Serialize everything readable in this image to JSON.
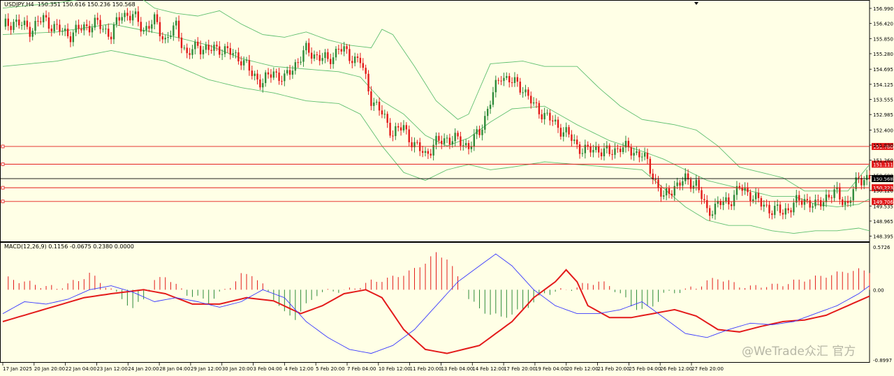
{
  "header": {
    "symbol": "USDJPY,H4",
    "ohlc": "150.351 150.616 150.236 150.568"
  },
  "macd_header": "MACD(12,26,9) 0.1156 -0.0675 0.2380 0.0000",
  "watermark": "@WeTrade众汇 官方",
  "colors": {
    "background": "#ffffe6",
    "bull": "#2e8b3a",
    "bear": "#e31a1a",
    "bands": "#5fbf6f",
    "macd_signal": "#e31a1a",
    "macd_main": "#3a3aff",
    "hline": "#e31a1a",
    "current_price": "#000000"
  },
  "chart_data": [
    {
      "type": "candlestick",
      "symbol": "USDJPY",
      "timeframe": "H4",
      "ylim": [
        148.2,
        157.2
      ],
      "price_ticks": [
        "156.990",
        "156.420",
        "155.850",
        "155.280",
        "154.695",
        "154.125",
        "153.555",
        "152.985",
        "152.400",
        "151.830",
        "151.260",
        "150.690",
        "150.120",
        "149.535",
        "148.965",
        "148.395"
      ],
      "time_labels": [
        "17 Jan 2025",
        "20 Jan 20:00",
        "22 Jan 04:00",
        "23 Jan 12:00",
        "24 Jan 20:00",
        "28 Jan 04:00",
        "29 Jan 12:00",
        "30 Jan 20:00",
        "3 Feb 04:00",
        "4 Feb 12:00",
        "5 Feb 20:00",
        "7 Feb 04:00",
        "10 Feb 12:00",
        "11 Feb 20:00",
        "13 Feb 04:00",
        "14 Feb 12:00",
        "17 Feb 20:00",
        "19 Feb 04:00",
        "20 Feb 12:00",
        "21 Feb 20:00",
        "25 Feb 04:00",
        "26 Feb 12:00",
        "27 Feb 20:00"
      ],
      "horizontal_lines": [
        {
          "price": 151.78,
          "label": "151.780"
        },
        {
          "price": 151.111,
          "label": "151.111"
        },
        {
          "price": 150.223,
          "label": "150.223"
        },
        {
          "price": 149.706,
          "label": "149.706"
        }
      ],
      "current_price": {
        "price": 150.568,
        "label": "150.568"
      },
      "close_path": [
        [
          0,
          156.3
        ],
        [
          4,
          156.5
        ],
        [
          10,
          156.2
        ],
        [
          15,
          156.6
        ],
        [
          20,
          156.2
        ],
        [
          25,
          156.0
        ],
        [
          30,
          156.3
        ],
        [
          35,
          156.4
        ],
        [
          40,
          156.0
        ],
        [
          44,
          156.8
        ],
        [
          48,
          156.7
        ],
        [
          52,
          156.2
        ],
        [
          56,
          156.5
        ],
        [
          60,
          155.8
        ],
        [
          64,
          156.3
        ],
        [
          68,
          155.2
        ],
        [
          72,
          155.6
        ],
        [
          76,
          155.4
        ],
        [
          80,
          155.5
        ],
        [
          84,
          155.3
        ],
        [
          88,
          155.1
        ],
        [
          92,
          154.5
        ],
        [
          96,
          154.2
        ],
        [
          100,
          154.6
        ],
        [
          104,
          154.3
        ],
        [
          108,
          154.9
        ],
        [
          112,
          155.4
        ],
        [
          116,
          155.2
        ],
        [
          120,
          155.0
        ],
        [
          124,
          155.5
        ],
        [
          128,
          155.2
        ],
        [
          132,
          155.0
        ],
        [
          136,
          153.6
        ],
        [
          140,
          153.0
        ],
        [
          144,
          152.3
        ],
        [
          148,
          152.5
        ],
        [
          152,
          151.8
        ],
        [
          156,
          151.5
        ],
        [
          160,
          151.9
        ],
        [
          164,
          152.1
        ],
        [
          168,
          152.0
        ],
        [
          172,
          151.8
        ],
        [
          176,
          152.3
        ],
        [
          180,
          153.5
        ],
        [
          184,
          154.5
        ],
        [
          188,
          154.2
        ],
        [
          192,
          154.0
        ],
        [
          196,
          153.3
        ],
        [
          200,
          153.0
        ],
        [
          204,
          152.6
        ],
        [
          208,
          152.3
        ],
        [
          212,
          151.8
        ],
        [
          216,
          151.6
        ],
        [
          220,
          151.7
        ],
        [
          224,
          151.5
        ],
        [
          228,
          151.8
        ],
        [
          232,
          151.6
        ],
        [
          236,
          151.5
        ],
        [
          240,
          150.7
        ],
        [
          244,
          149.8
        ],
        [
          248,
          150.3
        ],
        [
          252,
          150.5
        ],
        [
          256,
          150.4
        ],
        [
          260,
          149.3
        ],
        [
          264,
          149.6
        ],
        [
          268,
          149.7
        ],
        [
          272,
          150.2
        ],
        [
          276,
          150.0
        ],
        [
          280,
          149.6
        ],
        [
          284,
          149.4
        ],
        [
          288,
          149.3
        ],
        [
          292,
          149.6
        ],
        [
          296,
          149.8
        ],
        [
          300,
          149.5
        ],
        [
          304,
          149.9
        ],
        [
          308,
          150.0
        ],
        [
          312,
          149.6
        ],
        [
          316,
          150.6
        ],
        [
          320,
          150.57
        ]
      ],
      "bands_upper": [
        [
          0,
          157.0
        ],
        [
          20,
          157.2
        ],
        [
          40,
          157.5
        ],
        [
          48,
          157.6
        ],
        [
          56,
          157.0
        ],
        [
          64,
          156.8
        ],
        [
          72,
          156.7
        ],
        [
          80,
          156.9
        ],
        [
          88,
          156.4
        ],
        [
          96,
          156.0
        ],
        [
          104,
          155.9
        ],
        [
          112,
          156.1
        ],
        [
          120,
          155.8
        ],
        [
          128,
          155.6
        ],
        [
          136,
          155.5
        ],
        [
          140,
          156.2
        ],
        [
          144,
          156.0
        ],
        [
          152,
          154.8
        ],
        [
          160,
          153.5
        ],
        [
          168,
          152.8
        ],
        [
          172,
          153.0
        ],
        [
          180,
          154.9
        ],
        [
          192,
          155.0
        ],
        [
          200,
          154.8
        ],
        [
          212,
          154.8
        ],
        [
          220,
          154.0
        ],
        [
          228,
          153.3
        ],
        [
          236,
          152.8
        ],
        [
          248,
          152.6
        ],
        [
          256,
          152.4
        ],
        [
          264,
          151.8
        ],
        [
          272,
          151.0
        ],
        [
          280,
          150.8
        ],
        [
          288,
          150.6
        ],
        [
          296,
          150.1
        ],
        [
          304,
          150.1
        ],
        [
          312,
          150.1
        ],
        [
          320,
          151.1
        ]
      ],
      "bands_middle": [
        [
          0,
          156.0
        ],
        [
          20,
          156.1
        ],
        [
          40,
          156.4
        ],
        [
          60,
          156.0
        ],
        [
          76,
          155.6
        ],
        [
          88,
          155.1
        ],
        [
          100,
          154.8
        ],
        [
          112,
          154.7
        ],
        [
          124,
          154.6
        ],
        [
          132,
          154.4
        ],
        [
          140,
          153.5
        ],
        [
          148,
          153.0
        ],
        [
          156,
          152.2
        ],
        [
          164,
          151.8
        ],
        [
          172,
          152.1
        ],
        [
          180,
          152.7
        ],
        [
          188,
          153.2
        ],
        [
          200,
          153.3
        ],
        [
          212,
          152.6
        ],
        [
          224,
          152.0
        ],
        [
          236,
          151.6
        ],
        [
          244,
          151.3
        ],
        [
          252,
          150.9
        ],
        [
          260,
          150.5
        ],
        [
          268,
          150.3
        ],
        [
          276,
          150.1
        ],
        [
          284,
          149.9
        ],
        [
          292,
          149.9
        ],
        [
          300,
          149.6
        ],
        [
          308,
          149.5
        ],
        [
          316,
          149.6
        ],
        [
          320,
          149.8
        ]
      ],
      "bands_lower": [
        [
          0,
          154.8
        ],
        [
          20,
          155.0
        ],
        [
          40,
          155.4
        ],
        [
          60,
          155.0
        ],
        [
          76,
          154.3
        ],
        [
          88,
          154.0
        ],
        [
          100,
          153.8
        ],
        [
          112,
          153.5
        ],
        [
          124,
          153.4
        ],
        [
          132,
          153.0
        ],
        [
          140,
          151.8
        ],
        [
          148,
          150.8
        ],
        [
          156,
          150.5
        ],
        [
          164,
          150.9
        ],
        [
          172,
          151.1
        ],
        [
          180,
          150.9
        ],
        [
          188,
          151.0
        ],
        [
          200,
          151.2
        ],
        [
          212,
          151.1
        ],
        [
          224,
          151.0
        ],
        [
          236,
          150.9
        ],
        [
          244,
          150.2
        ],
        [
          252,
          149.5
        ],
        [
          260,
          149.0
        ],
        [
          268,
          148.8
        ],
        [
          276,
          148.8
        ],
        [
          284,
          148.6
        ],
        [
          292,
          148.5
        ],
        [
          300,
          148.6
        ],
        [
          308,
          148.6
        ],
        [
          316,
          148.7
        ],
        [
          320,
          148.6
        ]
      ]
    },
    {
      "type": "histogram_line",
      "name": "MACD(12,26,9)",
      "ylim": [
        -0.8997,
        0.5726
      ],
      "ticks": [
        "0.5726",
        "0.00",
        "-0.8997"
      ],
      "histogram_path": [
        [
          0,
          0.15
        ],
        [
          8,
          0.1
        ],
        [
          14,
          0.05
        ],
        [
          20,
          0.02
        ],
        [
          28,
          0.12
        ],
        [
          32,
          0.2
        ],
        [
          36,
          0.1
        ],
        [
          40,
          0.0
        ],
        [
          44,
          -0.1
        ],
        [
          48,
          -0.25
        ],
        [
          52,
          -0.1
        ],
        [
          56,
          0.1
        ],
        [
          60,
          0.18
        ],
        [
          64,
          0.05
        ],
        [
          68,
          -0.05
        ],
        [
          72,
          -0.1
        ],
        [
          76,
          -0.15
        ],
        [
          80,
          -0.05
        ],
        [
          84,
          0.05
        ],
        [
          88,
          0.18
        ],
        [
          92,
          0.2
        ],
        [
          96,
          0.05
        ],
        [
          100,
          -0.1
        ],
        [
          104,
          -0.3
        ],
        [
          108,
          -0.35
        ],
        [
          112,
          -0.2
        ],
        [
          116,
          -0.05
        ],
        [
          120,
          -0.02
        ],
        [
          128,
          0.0
        ],
        [
          136,
          0.1
        ],
        [
          144,
          0.15
        ],
        [
          152,
          0.25
        ],
        [
          156,
          0.35
        ],
        [
          160,
          0.45
        ],
        [
          164,
          0.4
        ],
        [
          168,
          0.15
        ],
        [
          172,
          -0.1
        ],
        [
          176,
          -0.25
        ],
        [
          180,
          -0.3
        ],
        [
          184,
          -0.35
        ],
        [
          188,
          -0.3
        ],
        [
          192,
          -0.25
        ],
        [
          196,
          -0.15
        ],
        [
          200,
          -0.05
        ],
        [
          204,
          -0.02
        ],
        [
          208,
          0.0
        ],
        [
          212,
          0.03
        ],
        [
          216,
          0.08
        ],
        [
          220,
          0.1
        ],
        [
          224,
          0.05
        ],
        [
          228,
          -0.05
        ],
        [
          232,
          -0.2
        ],
        [
          236,
          -0.25
        ],
        [
          240,
          -0.2
        ],
        [
          244,
          -0.05
        ],
        [
          248,
          -0.03
        ],
        [
          252,
          0.0
        ],
        [
          256,
          0.03
        ],
        [
          260,
          0.1
        ],
        [
          264,
          0.15
        ],
        [
          268,
          0.1
        ],
        [
          272,
          0.05
        ],
        [
          276,
          0.03
        ],
        [
          280,
          0.05
        ],
        [
          284,
          0.05
        ],
        [
          288,
          0.07
        ],
        [
          292,
          0.1
        ],
        [
          296,
          0.13
        ],
        [
          300,
          0.15
        ],
        [
          304,
          0.18
        ],
        [
          308,
          0.2
        ],
        [
          312,
          0.24
        ],
        [
          316,
          0.24
        ],
        [
          320,
          0.24
        ]
      ],
      "signal_path": [
        [
          0,
          -0.4
        ],
        [
          10,
          -0.3
        ],
        [
          20,
          -0.2
        ],
        [
          30,
          -0.1
        ],
        [
          40,
          -0.05
        ],
        [
          52,
          0.0
        ],
        [
          60,
          -0.05
        ],
        [
          70,
          -0.18
        ],
        [
          80,
          -0.18
        ],
        [
          90,
          -0.1
        ],
        [
          100,
          -0.14
        ],
        [
          110,
          -0.3
        ],
        [
          118,
          -0.2
        ],
        [
          126,
          -0.05
        ],
        [
          134,
          0.0
        ],
        [
          140,
          -0.1
        ],
        [
          148,
          -0.5
        ],
        [
          156,
          -0.75
        ],
        [
          164,
          -0.8
        ],
        [
          176,
          -0.7
        ],
        [
          188,
          -0.4
        ],
        [
          196,
          -0.1
        ],
        [
          204,
          0.1
        ],
        [
          208,
          0.25
        ],
        [
          212,
          0.1
        ],
        [
          216,
          -0.2
        ],
        [
          224,
          -0.35
        ],
        [
          232,
          -0.35
        ],
        [
          240,
          -0.3
        ],
        [
          248,
          -0.25
        ],
        [
          256,
          -0.33
        ],
        [
          264,
          -0.5
        ],
        [
          272,
          -0.53
        ],
        [
          280,
          -0.46
        ],
        [
          288,
          -0.4
        ],
        [
          296,
          -0.38
        ],
        [
          304,
          -0.32
        ],
        [
          312,
          -0.2
        ],
        [
          320,
          -0.08
        ]
      ],
      "main_path": [
        [
          0,
          -0.3
        ],
        [
          8,
          -0.15
        ],
        [
          16,
          -0.18
        ],
        [
          24,
          -0.12
        ],
        [
          32,
          0.0
        ],
        [
          40,
          0.05
        ],
        [
          48,
          -0.03
        ],
        [
          56,
          -0.15
        ],
        [
          64,
          -0.1
        ],
        [
          72,
          -0.15
        ],
        [
          80,
          -0.22
        ],
        [
          88,
          -0.15
        ],
        [
          96,
          0.0
        ],
        [
          104,
          -0.1
        ],
        [
          112,
          -0.4
        ],
        [
          120,
          -0.6
        ],
        [
          128,
          -0.75
        ],
        [
          136,
          -0.8
        ],
        [
          144,
          -0.7
        ],
        [
          152,
          -0.5
        ],
        [
          160,
          -0.2
        ],
        [
          168,
          0.1
        ],
        [
          176,
          0.3
        ],
        [
          182,
          0.45
        ],
        [
          188,
          0.3
        ],
        [
          196,
          0.0
        ],
        [
          204,
          -0.2
        ],
        [
          212,
          -0.3
        ],
        [
          220,
          -0.3
        ],
        [
          228,
          -0.25
        ],
        [
          236,
          -0.15
        ],
        [
          244,
          -0.35
        ],
        [
          252,
          -0.55
        ],
        [
          260,
          -0.6
        ],
        [
          268,
          -0.5
        ],
        [
          276,
          -0.42
        ],
        [
          284,
          -0.44
        ],
        [
          292,
          -0.4
        ],
        [
          300,
          -0.3
        ],
        [
          308,
          -0.2
        ],
        [
          316,
          -0.05
        ],
        [
          320,
          0.05
        ]
      ]
    }
  ]
}
